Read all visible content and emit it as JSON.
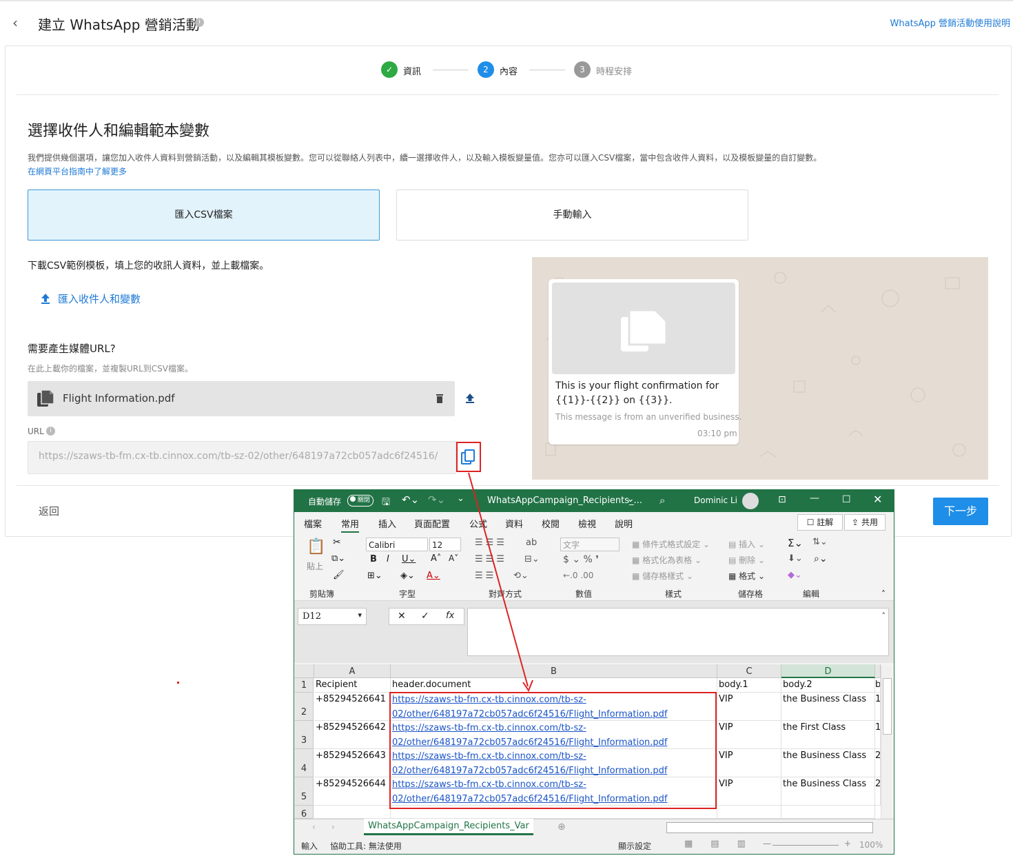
{
  "header": {
    "title": "建立 WhatsApp 營銷活動",
    "help_link": "WhatsApp 營銷活動使用說明"
  },
  "steps": [
    {
      "num": "✓",
      "label": "資訊",
      "state": "done",
      "color": "#2eaa44"
    },
    {
      "num": "2",
      "label": "內容",
      "state": "active",
      "color": "#1e8ee8"
    },
    {
      "num": "3",
      "label": "時程安排",
      "state": "pending",
      "color": "#999999"
    }
  ],
  "section": {
    "title": "選擇收件人和編輯範本變數",
    "description": "我們提供幾個選項，讓您加入收件人資料到營銷活動，以及編輯其模板變數。您可以從聯絡人列表中，續一選擇收件人，以及輸入模板變量值。您亦可以匯入CSV檔案，當中包含收件人資料，以及模板變量的自訂變數。",
    "learn_more": "在網頁平台指南中了解更多"
  },
  "options": {
    "csv": "匯入CSV檔案",
    "manual": "手動輸入"
  },
  "csv": {
    "download_text": "下載CSV範例模板，填上您的收訊人資料，並上載檔案。",
    "upload_link": "匯入收件人和變數",
    "need_url": "需要產生媒體URL?",
    "upload_hint": "在此上載你的檔案，並複製URL到CSV檔案。",
    "file_name": "Flight Information.pdf",
    "url_label": "URL",
    "url_value": "https://szaws-tb-fm.cx-tb.cinnox.com/tb-sz-02/other/648197a72cb057adc6f24516/"
  },
  "footer": {
    "back": "返回",
    "next": "下一步"
  },
  "preview": {
    "message": "This is your flight confirmation for {{1}}-{{2}} on {{3}}.",
    "note": "This message is from an unverified business.",
    "time": "03:10 pm"
  },
  "excel": {
    "autosave": "自動儲存",
    "autosave_state": "關閉",
    "filename": "WhatsAppCampaign_Recipients_...",
    "user": "Dominic Li",
    "menu": [
      "檔案",
      "常用",
      "插入",
      "頁面配置",
      "公式",
      "資料",
      "校閱",
      "檢視",
      "說明"
    ],
    "active_menu": "常用",
    "comment_btn": "註解",
    "share_btn": "共用",
    "font_name": "Calibri",
    "font_size": "12",
    "number_format": "文字",
    "ribbon": {
      "paste": "貼上",
      "clipboard": "剪貼簿",
      "font": "字型",
      "alignment": "對齊方式",
      "number": "數值",
      "styles": "樣式",
      "cond_format": "條件式格式設定",
      "format_table": "格式化為表格",
      "cell_styles": "儲存格樣式",
      "cells": "儲存格",
      "insert": "插入",
      "delete": "刪除",
      "format": "格式",
      "editing": "編輯"
    },
    "name_box": "D12",
    "columns": [
      "A",
      "B",
      "C",
      "D"
    ],
    "rows": [
      {
        "num": "1",
        "a": "Recipient",
        "b1": "header.document",
        "b2": "",
        "c": "body.1",
        "d": "body.2",
        "e": "b"
      },
      {
        "num": "2",
        "a": "+85294526641",
        "b1": "https://szaws-tb-fm.cx-tb.cinnox.com/tb-sz-",
        "b2": "02/other/648197a72cb057adc6f24516/Flight_Information.pdf",
        "c": "VIP",
        "d": "the Business Class",
        "e": "1"
      },
      {
        "num": "3",
        "a": "+85294526642",
        "b1": "https://szaws-tb-fm.cx-tb.cinnox.com/tb-sz-",
        "b2": "02/other/648197a72cb057adc6f24516/Flight_Information.pdf",
        "c": "VIP",
        "d": "the First Class",
        "e": "1"
      },
      {
        "num": "4",
        "a": "+85294526643",
        "b1": "https://szaws-tb-fm.cx-tb.cinnox.com/tb-sz-",
        "b2": "02/other/648197a72cb057adc6f24516/Flight_Information.pdf",
        "c": "VIP",
        "d": "the Business Class",
        "e": "2"
      },
      {
        "num": "5",
        "a": "+85294526644",
        "b1": "https://szaws-tb-fm.cx-tb.cinnox.com/tb-sz-",
        "b2": "02/other/648197a72cb057adc6f24516/Flight_Information.pdf",
        "c": "VIP",
        "d": "the Business Class",
        "e": "2"
      },
      {
        "num": "6",
        "a": "",
        "b1": "",
        "b2": "",
        "c": "",
        "d": "",
        "e": ""
      }
    ],
    "sheet_tab": "WhatsAppCampaign_Recipients_Var",
    "status_left": "輸入",
    "accessibility": "協助工具: 無法使用",
    "display_settings": "顯示設定",
    "zoom": "100%"
  },
  "colors": {
    "accent": "#1e8ee8",
    "excel_green": "#217346",
    "annotation_red": "#dd2222"
  }
}
